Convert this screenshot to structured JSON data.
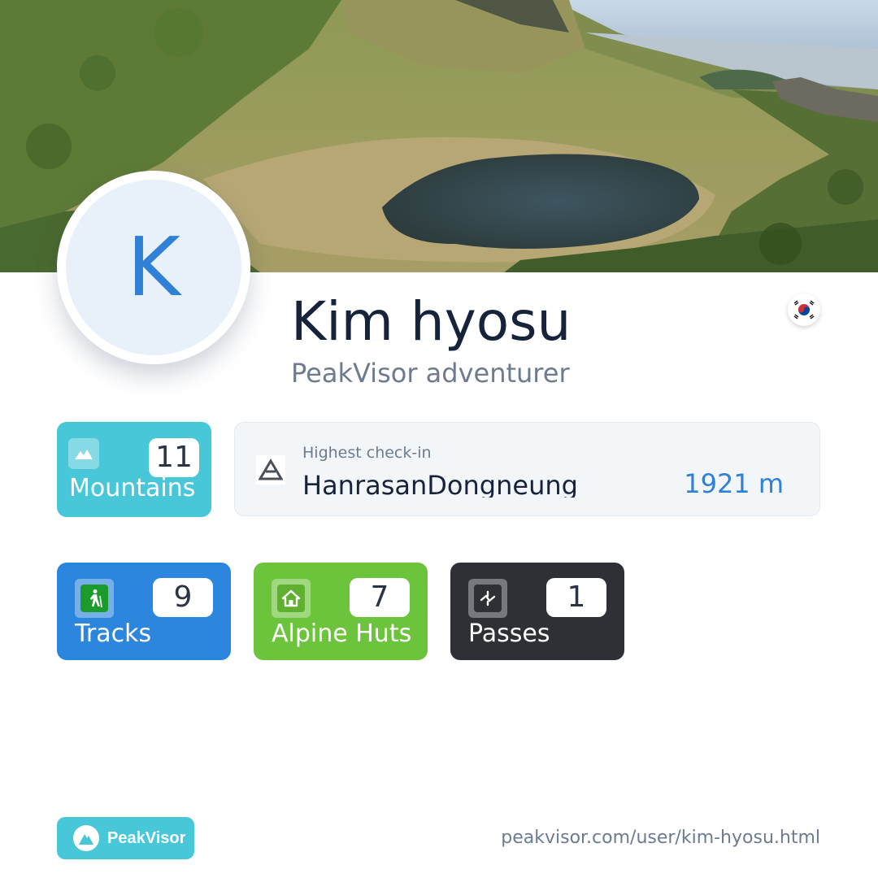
{
  "profile": {
    "initial": "K",
    "name": "Kim hyosu",
    "subtitle": "PeakVisor adventurer",
    "country_flag": "south-korea-flag-icon"
  },
  "stats": {
    "mountains": {
      "count": "11",
      "label": "Mountains",
      "icon": "mountain-icon",
      "color": "#47c7d7"
    },
    "tracks": {
      "count": "9",
      "label": "Tracks",
      "icon": "hiker-icon",
      "color": "#2c86dd"
    },
    "huts": {
      "count": "7",
      "label": "Alpine Huts",
      "icon": "hut-icon",
      "color": "#6cc33c"
    },
    "passes": {
      "count": "1",
      "label": "Passes",
      "icon": "pass-icon",
      "color": "#2e3035"
    }
  },
  "highest_checkin": {
    "label": "Highest check-in",
    "peak": "HanrasanDongneung",
    "elevation": "1921 m",
    "icon": "peak-triangle-icon"
  },
  "footer": {
    "brand": "PeakVisor",
    "url": "peakvisor.com/user/kim-hyosu.html"
  }
}
